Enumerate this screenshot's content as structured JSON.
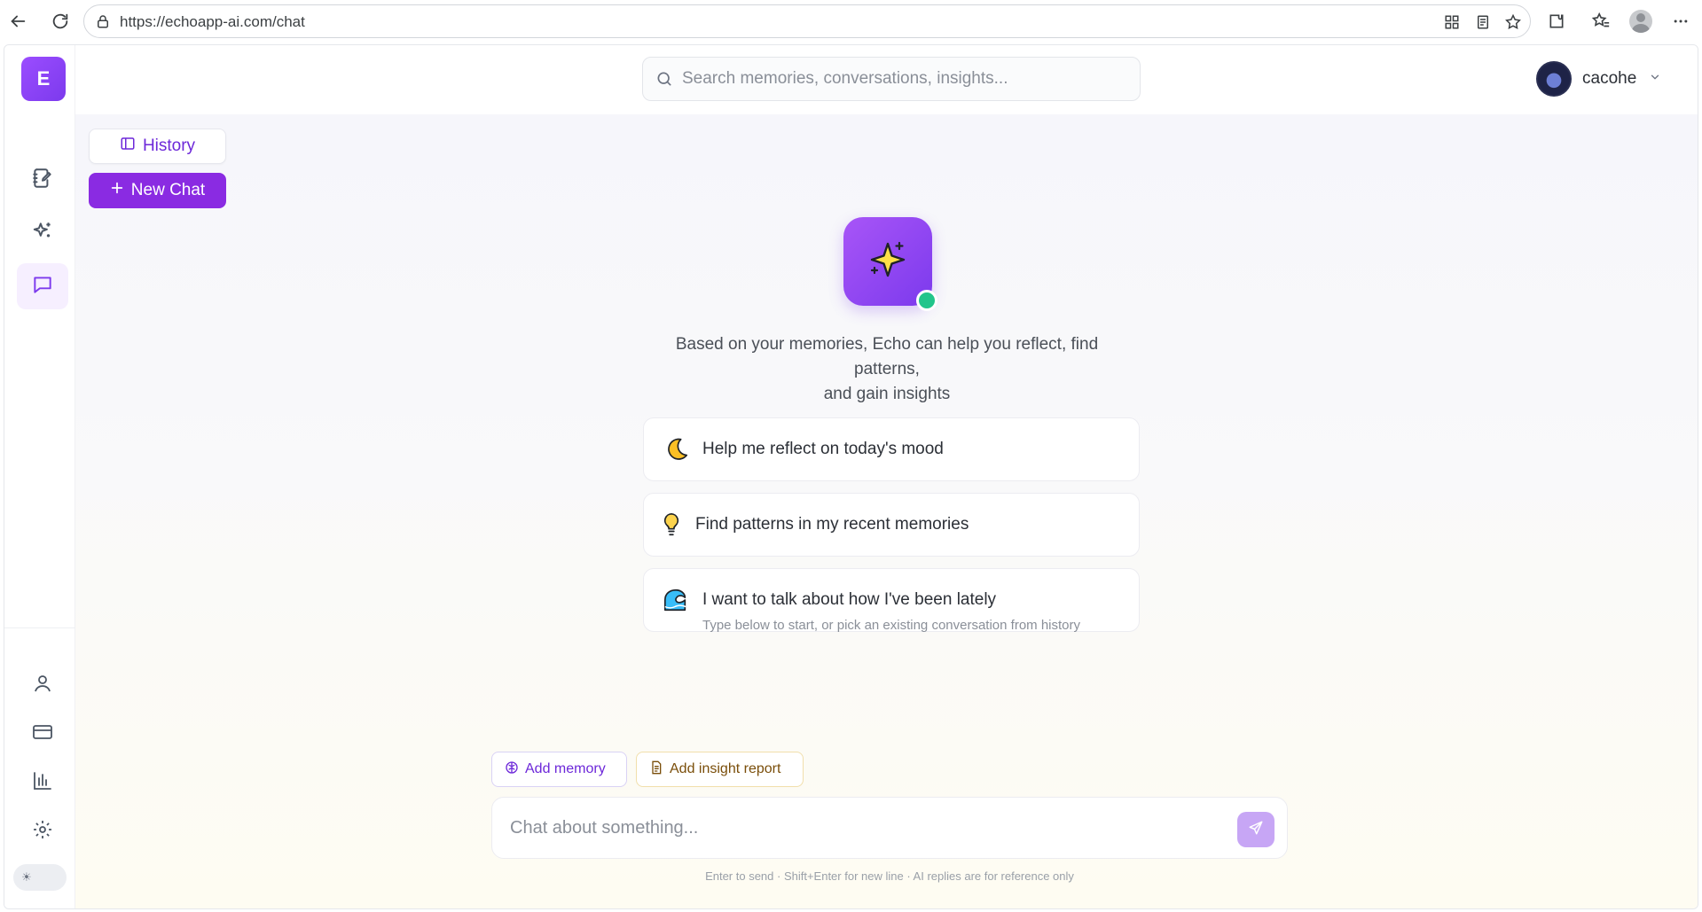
{
  "browser": {
    "url": "https://echoapp-ai.com/chat"
  },
  "sidebar": {
    "logo_letter": "E",
    "items": [
      {
        "icon": "journal-edit-icon"
      },
      {
        "icon": "sparkles-icon"
      },
      {
        "icon": "chat-bubble-icon",
        "active": true
      },
      {
        "icon": "user-icon"
      },
      {
        "icon": "credit-card-icon"
      },
      {
        "icon": "bar-chart-icon"
      },
      {
        "icon": "gear-icon"
      }
    ],
    "theme_toggle": {
      "icon": "sun-icon"
    }
  },
  "header": {
    "search_placeholder": "Search memories, conversations, insights...",
    "username": "cacohe"
  },
  "history": {
    "history_label": "History",
    "new_chat_label": "New Chat"
  },
  "main": {
    "intro_line1": "Based on your memories, Echo can help you reflect, find patterns,",
    "intro_line2": "and gain insights",
    "prompts": [
      {
        "emoji": "crescent-moon-icon",
        "text": "Help me reflect on today's mood"
      },
      {
        "emoji": "lightbulb-icon",
        "text": "Find patterns in my recent memories"
      },
      {
        "emoji": "wave-icon",
        "text": "I want to talk about how I've been lately"
      }
    ],
    "hint": "Type below to start, or pick an existing conversation from history"
  },
  "composer": {
    "add_memory": "Add memory",
    "add_insight": "Add insight report",
    "placeholder": "Chat about something...",
    "footnote": "Enter to send · Shift+Enter for new line · AI replies are for reference only"
  },
  "colors": {
    "brand": "#8a2be2",
    "online": "#22c58b"
  }
}
